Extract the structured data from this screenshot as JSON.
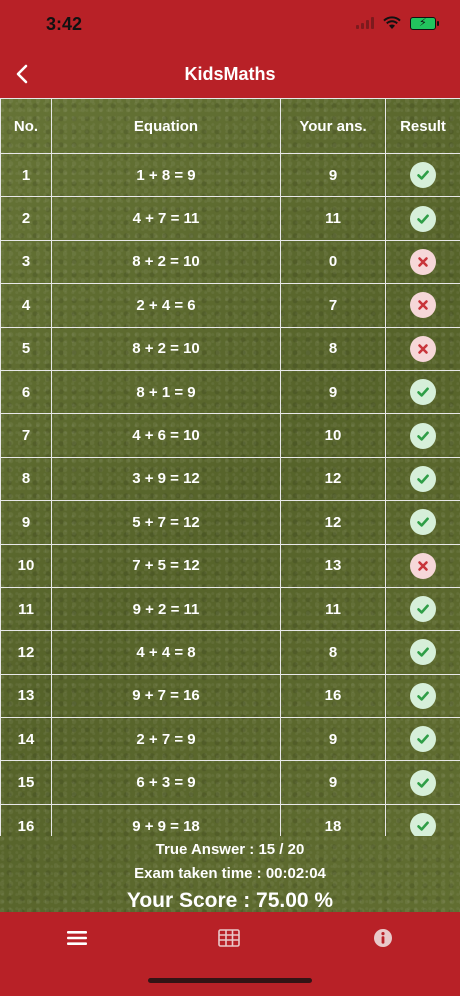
{
  "status": {
    "time": "3:42"
  },
  "nav": {
    "title": "KidsMaths"
  },
  "table": {
    "headers": {
      "no": "No.",
      "equation": "Equation",
      "answer": "Your ans.",
      "result": "Result"
    },
    "rows": [
      {
        "no": "1",
        "equation": "1 + 8 = 9",
        "answer": "9",
        "correct": true
      },
      {
        "no": "2",
        "equation": "4 + 7 = 11",
        "answer": "11",
        "correct": true
      },
      {
        "no": "3",
        "equation": "8 + 2 = 10",
        "answer": "0",
        "correct": false
      },
      {
        "no": "4",
        "equation": "2 + 4 = 6",
        "answer": "7",
        "correct": false
      },
      {
        "no": "5",
        "equation": "8 + 2 = 10",
        "answer": "8",
        "correct": false
      },
      {
        "no": "6",
        "equation": "8 + 1 = 9",
        "answer": "9",
        "correct": true
      },
      {
        "no": "7",
        "equation": "4 + 6 = 10",
        "answer": "10",
        "correct": true
      },
      {
        "no": "8",
        "equation": "3 + 9 = 12",
        "answer": "12",
        "correct": true
      },
      {
        "no": "9",
        "equation": "5 + 7 = 12",
        "answer": "12",
        "correct": true
      },
      {
        "no": "10",
        "equation": "7 + 5 = 12",
        "answer": "13",
        "correct": false
      },
      {
        "no": "11",
        "equation": "9 + 2 = 11",
        "answer": "11",
        "correct": true
      },
      {
        "no": "12",
        "equation": "4 + 4 = 8",
        "answer": "8",
        "correct": true
      },
      {
        "no": "13",
        "equation": "9 + 7 = 16",
        "answer": "16",
        "correct": true
      },
      {
        "no": "14",
        "equation": "2 + 7 = 9",
        "answer": "9",
        "correct": true
      },
      {
        "no": "15",
        "equation": "6 + 3 = 9",
        "answer": "9",
        "correct": true
      },
      {
        "no": "16",
        "equation": "9 + 9 = 18",
        "answer": "18",
        "correct": true
      }
    ]
  },
  "summary": {
    "true_answer": "True Answer : 15 / 20",
    "exam_time": "Exam taken time : 00:02:04",
    "score": "Your Score : 75.00 %"
  },
  "icons": {
    "correct": "check-circle-icon",
    "wrong": "x-circle-icon",
    "tabs": [
      "list-icon",
      "table-icon",
      "info-icon"
    ]
  },
  "colors": {
    "header_red": "#b82127",
    "board_green": "#5d6a2f",
    "correct_green": "#2f9e47",
    "wrong_red": "#c8353a"
  }
}
